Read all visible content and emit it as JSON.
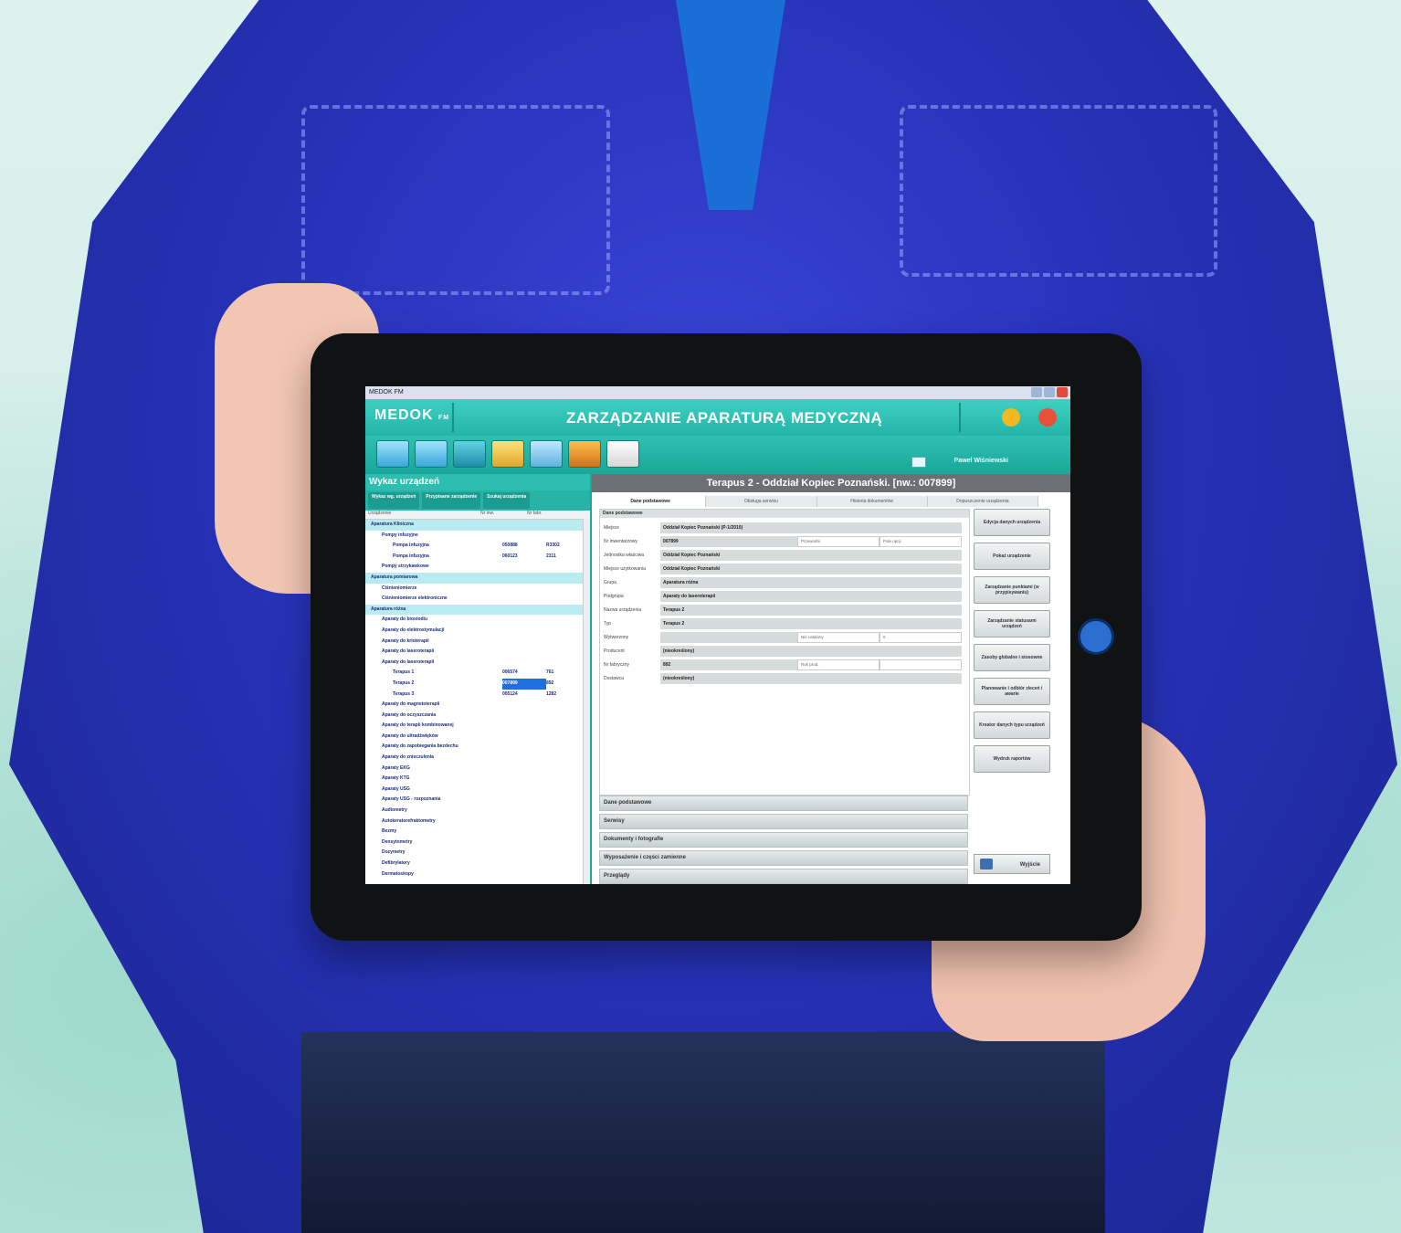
{
  "window": {
    "title": "MEDOK FM"
  },
  "header": {
    "logo": "MEDOK",
    "logo_suffix": "FM",
    "app_title": "ZARZĄDZANIE APARATURĄ MEDYCZNĄ",
    "user_name": "Paweł Wiśniewski"
  },
  "colors": {
    "accent": "#22b5a7",
    "header_dark": "#1aa699",
    "selection": "#1f6fe0",
    "title_gray": "#6c6f73"
  },
  "left_panel": {
    "title": "Wykaz urządzeń",
    "buttons": [
      "Wykaz wg. urządzeń",
      "Przypisane zarządzenie",
      "Szukaj urządzenia"
    ],
    "columns": [
      "Urządzenie",
      "Nr inw.",
      "Nr fabr."
    ],
    "rows": [
      {
        "label": "Aparatura Kliniczna",
        "inv": "",
        "fab": "",
        "group": true
      },
      {
        "label": "Pompy infuzyjne",
        "inv": "",
        "fab": ""
      },
      {
        "label": "Pompa infuzyjna",
        "inv": "050888",
        "fab": "R3302"
      },
      {
        "label": "Pompa infuzyjna",
        "inv": "060123",
        "fab": "2311"
      },
      {
        "label": "Pompy strzykawkowe",
        "inv": "",
        "fab": ""
      },
      {
        "label": "Aparatura pomiarowa",
        "inv": "",
        "fab": "",
        "group": true
      },
      {
        "label": "Ciśnieniomierze",
        "inv": "",
        "fab": ""
      },
      {
        "label": "Ciśnieniomierze elektroniczne",
        "inv": "",
        "fab": ""
      },
      {
        "label": "Aparatura różna",
        "inv": "",
        "fab": "",
        "group": true
      },
      {
        "label": "Aparaty do biostodiu",
        "inv": "",
        "fab": ""
      },
      {
        "label": "Aparaty do elektrostymulacji",
        "inv": "",
        "fab": ""
      },
      {
        "label": "Aparaty do krioterapii",
        "inv": "",
        "fab": ""
      },
      {
        "label": "Aparaty do laseroterapii",
        "inv": "",
        "fab": ""
      },
      {
        "label": "Aparaty do laseroterapii",
        "inv": "",
        "fab": ""
      },
      {
        "label": "Terapus 1",
        "inv": "006574",
        "fab": "761"
      },
      {
        "label": "Terapus 2",
        "inv": "007899",
        "fab": "892",
        "selected": true
      },
      {
        "label": "Terapus 3",
        "inv": "005124",
        "fab": "1282"
      },
      {
        "label": "Aparaty do magnetoterapii",
        "inv": "",
        "fab": ""
      },
      {
        "label": "Aparaty do oczyszczania",
        "inv": "",
        "fab": ""
      },
      {
        "label": "Aparaty do terapii kombinowanej",
        "inv": "",
        "fab": ""
      },
      {
        "label": "Aparaty do ultradźwięków",
        "inv": "",
        "fab": ""
      },
      {
        "label": "Aparaty do zapobiegania bezdechu",
        "inv": "",
        "fab": ""
      },
      {
        "label": "Aparaty do znieczulenia",
        "inv": "",
        "fab": ""
      },
      {
        "label": "Aparaty EKG",
        "inv": "",
        "fab": ""
      },
      {
        "label": "Aparaty KTG",
        "inv": "",
        "fab": ""
      },
      {
        "label": "Aparaty USG",
        "inv": "",
        "fab": ""
      },
      {
        "label": "Aparaty USG - rozpoznania",
        "inv": "",
        "fab": ""
      },
      {
        "label": "Audiometry",
        "inv": "",
        "fab": ""
      },
      {
        "label": "Autokeratorefraktometry",
        "inv": "",
        "fab": ""
      },
      {
        "label": "Bezmy",
        "inv": "",
        "fab": ""
      },
      {
        "label": "Densytometry",
        "inv": "",
        "fab": ""
      },
      {
        "label": "Dozymetry",
        "inv": "",
        "fab": ""
      },
      {
        "label": "Defibrylatory",
        "inv": "",
        "fab": ""
      },
      {
        "label": "Dermatoskopy",
        "inv": "",
        "fab": ""
      }
    ]
  },
  "detail": {
    "title": "Terapus 2 - Oddział Kopiec Poznański.  [nw.: 007899]",
    "tabs": [
      "Dane podstawowe",
      "Obsługa serwisu",
      "Historia dokumentów",
      "Dopuszczenie urządzenia"
    ],
    "section_title": "Dane podstawowe",
    "fields": [
      {
        "label": "Miejsce",
        "value": "Oddział Kopiec Poznański (P-1/2010)"
      },
      {
        "label": "Nr inwentarzowy",
        "value": "007899",
        "extra": "Przewodni",
        "extra2": "Pole opcji"
      },
      {
        "label": "Jednostka właściwa",
        "value": "Oddział Kopiec Poznański"
      },
      {
        "label": "Miejsce użytkowania",
        "value": "Oddział Kopiec Poznański"
      },
      {
        "label": "Grupa",
        "value": "Aparatura różna"
      },
      {
        "label": "Podgrupa",
        "value": "Aparaty do laseroterapii"
      },
      {
        "label": "Nazwa urządzenia",
        "value": "Terapus 2"
      },
      {
        "label": "Typ",
        "value": "Terapus 2"
      },
      {
        "label": "Wytworzony",
        "value": "",
        "extra": "Nie ustalony",
        "extra2": "0"
      },
      {
        "label": "Producent",
        "value": "(nieokreślony)"
      },
      {
        "label": "Nr fabryczny",
        "value": "892",
        "extra": "Rok prod.",
        "extra2": ""
      },
      {
        "label": "Dostawca",
        "value": "(nieokreślony)"
      }
    ],
    "sections": [
      "Dane podstawowe",
      "Serwisy",
      "Dokumenty i fotografie",
      "Wyposażenie i części zamienne",
      "Przeglądy"
    ]
  },
  "actions": {
    "buttons": [
      "Edycja danych urządzenia",
      "Pokaż urządzenie",
      "Zarządzanie punktami (w przypisywaniu)",
      "Zarządzanie statusami urządzeń",
      "Zasoby globalne i stosowne",
      "Planowanie i odbiór zleceń i awarie",
      "Kreator danych typu urządzeń",
      "Wydruk raportów"
    ],
    "exit_label": "Wyjście"
  }
}
